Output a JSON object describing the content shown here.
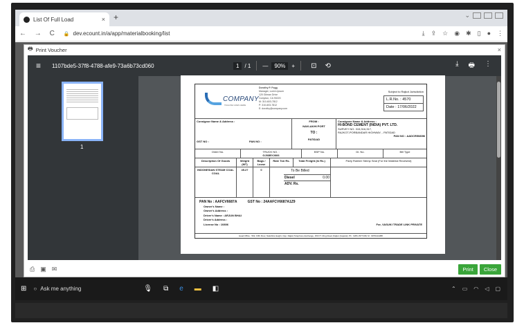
{
  "browser": {
    "tab_title": "List Of Full Load",
    "tab_close": "×",
    "new_tab": "+",
    "url": "dev.ecount.in/a/app/materialbooking/list"
  },
  "modal": {
    "title": "Print Voucher",
    "close": "×",
    "print_label": "Print",
    "close_label": "Close"
  },
  "viewer": {
    "file_name": "1107bde5-37f8-4788-afe9-73a6b73cd060",
    "page_current": "1",
    "page_total": "/ 1",
    "zoom": "90%",
    "minus": "—",
    "plus": "+",
    "thumb_page": "1"
  },
  "doc": {
    "company": "COMPANY",
    "tagline": "TAGLINE GOES HERE",
    "address": [
      "Dorothy P. Fogg",
      "Manager, Lorem Ipsum",
      "120 Gilman Drive",
      "Compton, CA 90220",
      "M: 310-603-7812",
      "P: 310-603-7812",
      "E: dorothy@company.com"
    ],
    "jurisdiction": "Subject to Rajkot Jurisdiction",
    "lr_no": "L.R.No. : 4570",
    "date": "Date : 17/06/2022",
    "consignor_label": "Consignor Name & Address :",
    "consignor_gst": "GST NO :",
    "consignor_pan": "PAN NO :",
    "from_label": "FROM :",
    "from_value": "NAVLAKHI PORT",
    "to_label": "TO :",
    "to_value": "PATIDAD",
    "consignee_label": "Consignee Name & Address :",
    "consignee_name": "HI-BOND CEMENT (INDIA) PVT. LTD.",
    "consignee_addr1": "SURVEY NO. 315,316,317,",
    "consignee_addr2": "RAJKOT-PORBANDAR HIGHWAY, - PATIDAD",
    "consignee_pan": "PAN NO : AADCR5080M",
    "order_no": "Order No.",
    "truck_no": "TRUCK NO. :",
    "truck_value": "GJ03BY2666",
    "bsp_no": "BSP No.",
    "dl_no": "Dl. No.",
    "bill_type": "Bill Type",
    "desc_head": "Description Of Goods",
    "weight_head": "Weight (MT)",
    "bags_head": "Bags / Loose",
    "rate_head": "Rate Ton Rs.",
    "freight_head": "Total Freight (In Rs.)",
    "seal_head": "Party Rubber Stemp Seal (For the Material Received)",
    "goods": "INDONESIAN STEAM COAL COAL",
    "weight": "45.27",
    "bags": "0",
    "to_be_billed": "To Be Billed",
    "diesel_label": "Diesel",
    "diesel_value": "0.00",
    "adv_label": "ADV. Rs.",
    "pan_no": "PAN No : AAFCV6687A",
    "gst_no": "GST No : 24AAFCV6687A1Z9",
    "owner_name": "Owner's Name :",
    "owner_address": "Owner's Address :",
    "driver_name": "Driver's Name : ARJUN BHAI",
    "driver_address": "Driver's Address :",
    "license": "License No : 10806",
    "for_company": "For, VASUKI TRADE LINK PRIVATE",
    "head_office": "Head Office : 502, Fifth Floor, Nakshtra Height, Opp. Rajkot Telephone Exchange, 150 FT. Ring Road, Rajkot (Gujarat). Ph : 0281 2577198, M : 9979142288"
  },
  "taskbar": {
    "search": "Ask me anything"
  }
}
